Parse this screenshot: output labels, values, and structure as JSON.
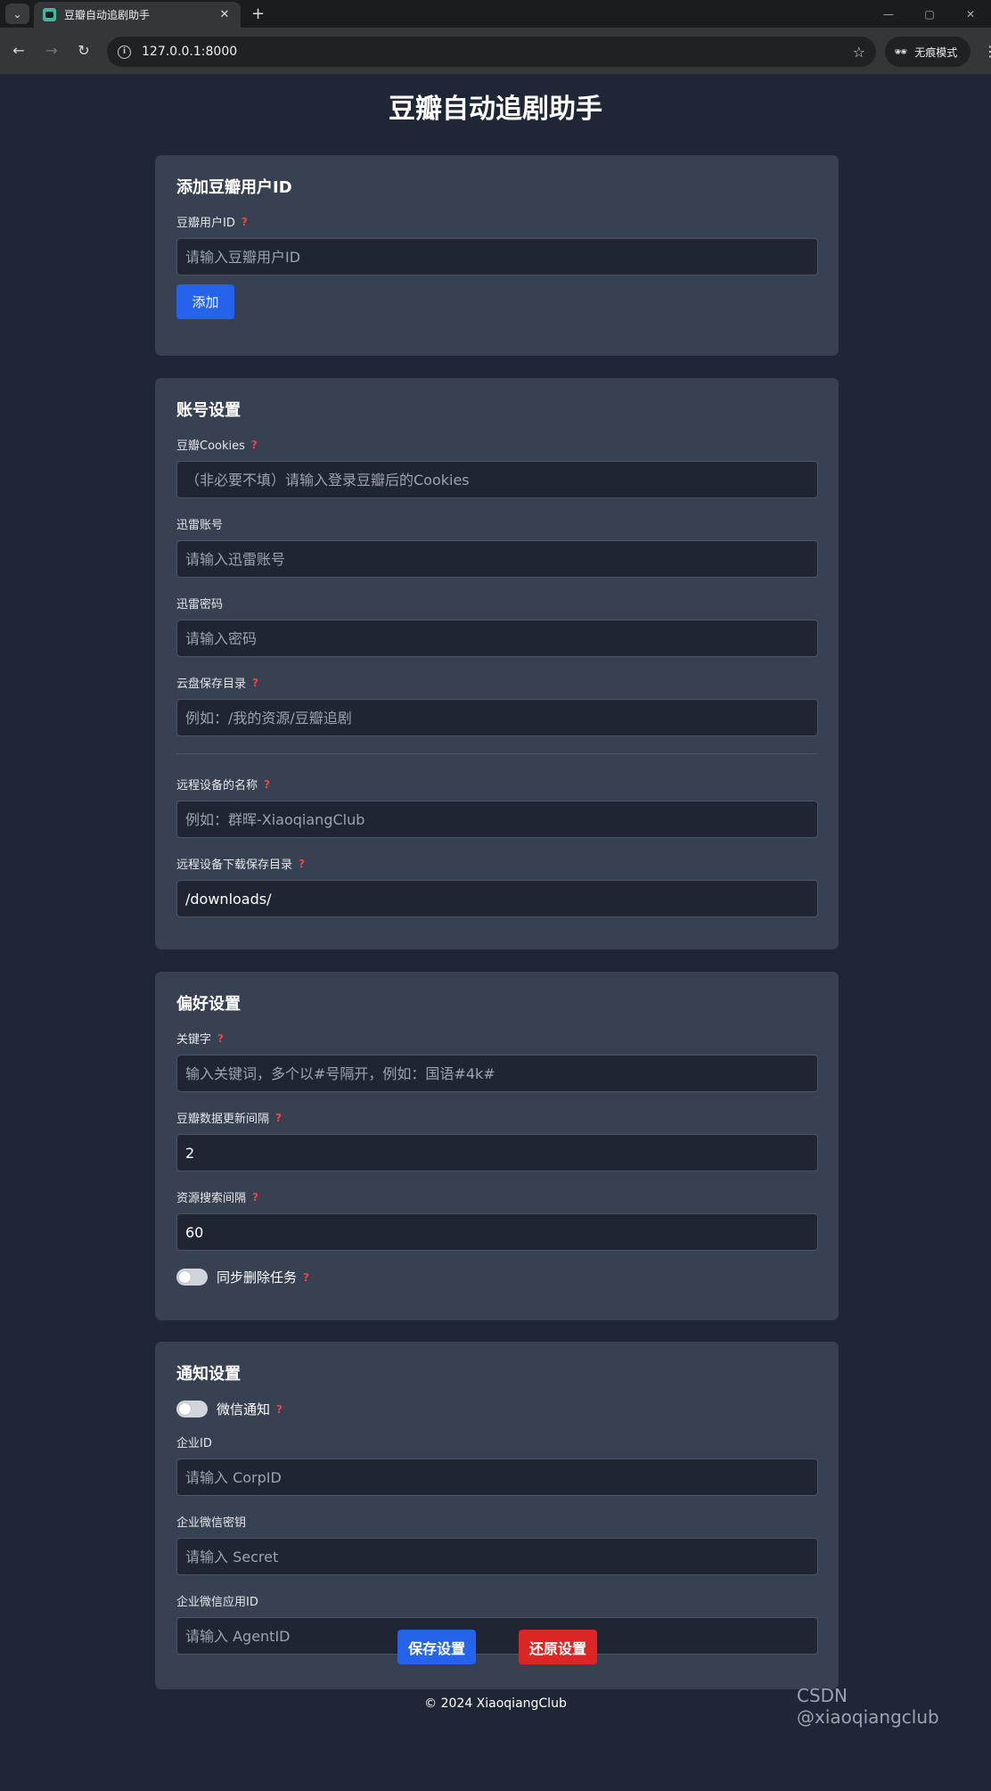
{
  "browser": {
    "tab_title": "豆瓣自动追剧助手",
    "tab_close": "✕",
    "new_tab": "+",
    "url": "127.0.0.1:8000",
    "incognito_label": "无痕模式"
  },
  "page": {
    "title": "豆瓣自动追剧助手"
  },
  "add_user": {
    "title": "添加豆瓣用户ID",
    "label": "豆瓣用户ID",
    "placeholder": "请输入豆瓣用户ID",
    "button": "添加"
  },
  "account": {
    "title": "账号设置",
    "cookies_label": "豆瓣Cookies",
    "cookies_placeholder": "（非必要不填）请输入登录豆瓣后的Cookies",
    "xunlei_account_label": "迅雷账号",
    "xunlei_account_placeholder": "请输入迅雷账号",
    "xunlei_password_label": "迅雷密码",
    "xunlei_password_placeholder": "请输入密码",
    "cloud_dir_label": "云盘保存目录",
    "cloud_dir_placeholder": "例如：/我的资源/豆瓣追剧",
    "remote_name_label": "远程设备的名称",
    "remote_name_placeholder": "例如：群晖-XiaoqiangClub",
    "remote_dir_label": "远程设备下载保存目录",
    "remote_dir_value": "/downloads/"
  },
  "preferences": {
    "title": "偏好设置",
    "keyword_label": "关键字",
    "keyword_placeholder": "输入关键词，多个以#号隔开，例如：国语#4k#",
    "update_interval_label": "豆瓣数据更新间隔",
    "update_interval_value": "2",
    "search_interval_label": "资源搜索间隔",
    "search_interval_value": "60",
    "sync_delete_label": "同步删除任务"
  },
  "notification": {
    "title": "通知设置",
    "wechat_label": "微信通知",
    "corp_id_label": "企业ID",
    "corp_id_placeholder": "请输入 CorpID",
    "secret_label": "企业微信密钥",
    "secret_placeholder": "请输入 Secret",
    "agent_id_label": "企业微信应用ID",
    "agent_id_placeholder": "请输入 AgentID"
  },
  "actions": {
    "save": "保存设置",
    "restore": "还原设置"
  },
  "footer": "© 2024 XiaoqiangClub",
  "watermark": "CSDN @xiaoqiangclub",
  "help_glyph": "?"
}
